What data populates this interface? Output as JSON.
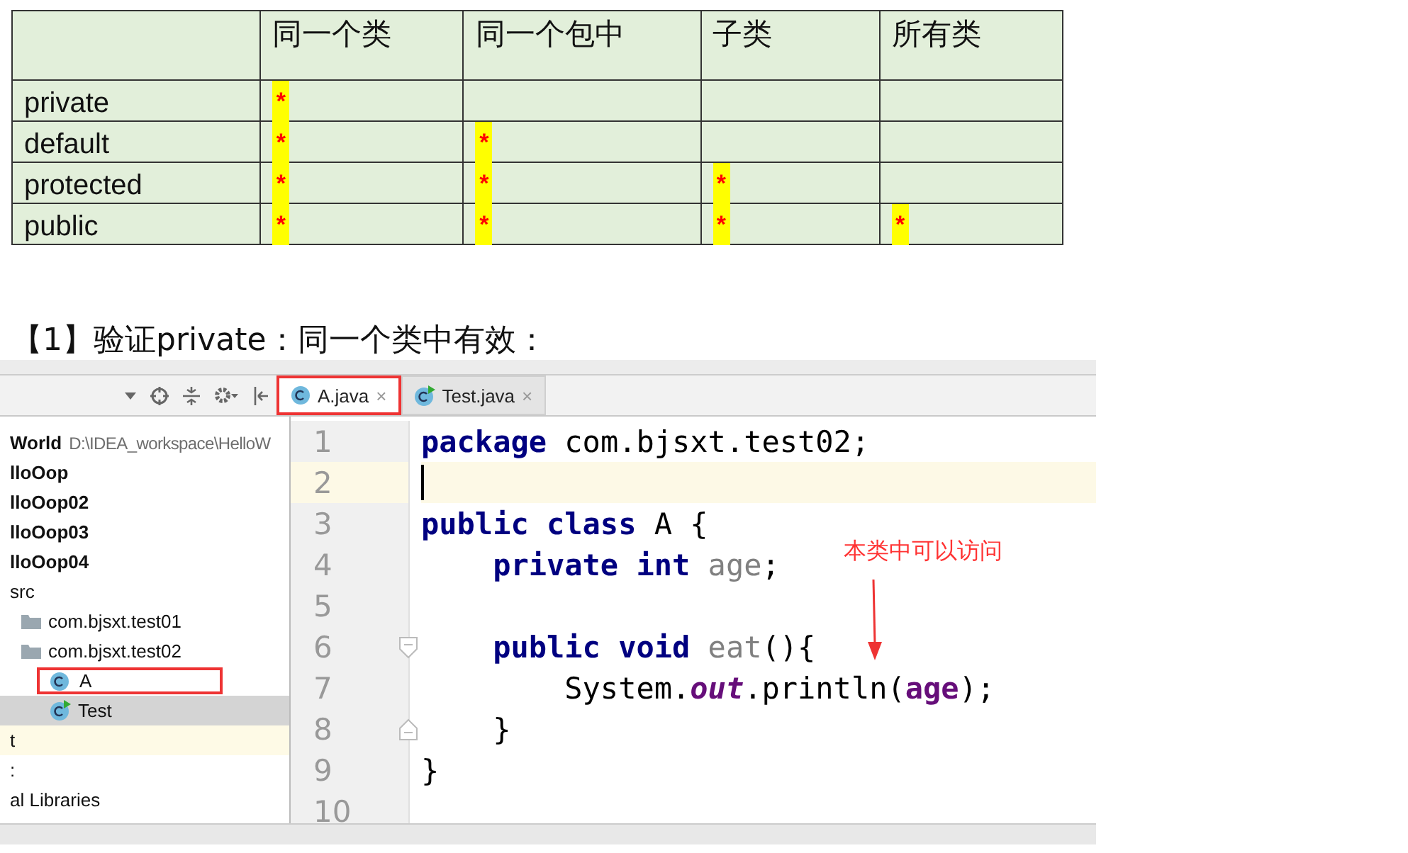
{
  "access_table": {
    "columns": [
      "同一个类",
      "同一个包中",
      "子类",
      "所有类"
    ],
    "rows": [
      {
        "label": "private",
        "cells": [
          {
            "allowed": true,
            "mark": "*"
          },
          {
            "allowed": false
          },
          {
            "allowed": false
          },
          {
            "allowed": false
          }
        ]
      },
      {
        "label": "default",
        "cells": [
          {
            "allowed": true,
            "mark": "*"
          },
          {
            "allowed": true,
            "mark": "*"
          },
          {
            "allowed": false
          },
          {
            "allowed": false
          }
        ]
      },
      {
        "label": "protected",
        "cells": [
          {
            "allowed": true,
            "mark": "*"
          },
          {
            "allowed": true,
            "mark": "*"
          },
          {
            "allowed": true,
            "mark": "*"
          },
          {
            "allowed": false
          }
        ]
      },
      {
        "label": "public",
        "cells": [
          {
            "allowed": true,
            "mark": "*"
          },
          {
            "allowed": true,
            "mark": "*"
          },
          {
            "allowed": true,
            "mark": "*"
          },
          {
            "allowed": true,
            "mark": "*"
          }
        ]
      }
    ]
  },
  "heading": "【1】验证private：同一个类中有效：",
  "ide": {
    "tabs": [
      {
        "label": "A.java",
        "kind": "class",
        "selected": true,
        "highlighted": true,
        "close": "×"
      },
      {
        "label": "Test.java",
        "kind": "runnable",
        "selected": false,
        "highlighted": false,
        "close": "×"
      }
    ],
    "project_tree": [
      {
        "label": "World",
        "bold": true,
        "path": "D:\\IDEA_workspace\\HelloW",
        "selected": false,
        "current": false
      },
      {
        "label": "lloOop",
        "bold": true,
        "selected": false,
        "current": false
      },
      {
        "label": "lloOop02",
        "bold": true,
        "selected": false,
        "current": false
      },
      {
        "label": "lloOop03",
        "bold": true,
        "selected": false,
        "current": false
      },
      {
        "label": "lloOop04",
        "bold": true,
        "selected": false,
        "current": false
      },
      {
        "label": "src",
        "bold": false,
        "selected": false,
        "current": false,
        "children": [
          {
            "label": "com.bjsxt.test01",
            "kind": "package",
            "bold": false,
            "selected": false,
            "current": false
          },
          {
            "label": "com.bjsxt.test02",
            "kind": "package",
            "bold": false,
            "selected": false,
            "current": false,
            "children": [
              {
                "label": "A",
                "kind": "class",
                "bold": false,
                "selected": false,
                "current": false,
                "highlighted": true
              },
              {
                "label": "Test",
                "kind": "runnable",
                "bold": false,
                "selected": true,
                "current": false,
                "highlighted": false
              }
            ]
          }
        ]
      },
      {
        "label": "t",
        "bold": false,
        "selected": false,
        "current": true
      },
      {
        "label": ":",
        "bold": false,
        "selected": false,
        "current": false
      },
      {
        "label": "al Libraries",
        "bold": false,
        "selected": false,
        "current": false
      }
    ],
    "code": [
      {
        "number": "1",
        "current": false,
        "fold_start": false,
        "fold_end": false,
        "tokens": [
          {
            "kind": "keyword",
            "text": "package"
          },
          {
            "kind": "plain",
            "text": " com.bjsxt.test02;"
          }
        ]
      },
      {
        "number": "2",
        "current": true,
        "fold_start": false,
        "fold_end": false
      },
      {
        "number": "3",
        "current": false,
        "fold_start": false,
        "fold_end": false,
        "tokens": [
          {
            "kind": "keyword",
            "text": "public class"
          },
          {
            "kind": "plain",
            "text": " A {"
          }
        ]
      },
      {
        "number": "4",
        "current": false,
        "fold_start": false,
        "fold_end": false,
        "tokens": [
          {
            "kind": "keyword",
            "text": "    private int"
          },
          {
            "kind": "unused",
            "text": " age"
          },
          {
            "kind": "plain",
            "text": ";"
          }
        ]
      },
      {
        "number": "5",
        "current": false,
        "fold_start": false,
        "fold_end": false
      },
      {
        "number": "6",
        "current": false,
        "fold_start": true,
        "fold_end": false,
        "tokens": [
          {
            "kind": "keyword",
            "text": "    public void"
          },
          {
            "kind": "unused",
            "text": " eat"
          },
          {
            "kind": "plain",
            "text": "(){"
          }
        ]
      },
      {
        "number": "7",
        "current": false,
        "fold_start": false,
        "fold_end": false,
        "tokens": [
          {
            "kind": "plain",
            "text": "        System."
          },
          {
            "kind": "static",
            "text": "out"
          },
          {
            "kind": "plain",
            "text": ".println("
          },
          {
            "kind": "field",
            "text": "age"
          },
          {
            "kind": "plain",
            "text": ");"
          }
        ]
      },
      {
        "number": "8",
        "current": false,
        "fold_start": false,
        "fold_end": true,
        "tokens": [
          {
            "kind": "plain",
            "text": "    }"
          }
        ]
      },
      {
        "number": "9",
        "current": false,
        "fold_start": false,
        "fold_end": false,
        "tokens": [
          {
            "kind": "plain",
            "text": "}"
          }
        ]
      },
      {
        "number": "10",
        "current": false,
        "fold_start": false,
        "fold_end": false
      }
    ],
    "annotation": "本类中可以访问"
  }
}
